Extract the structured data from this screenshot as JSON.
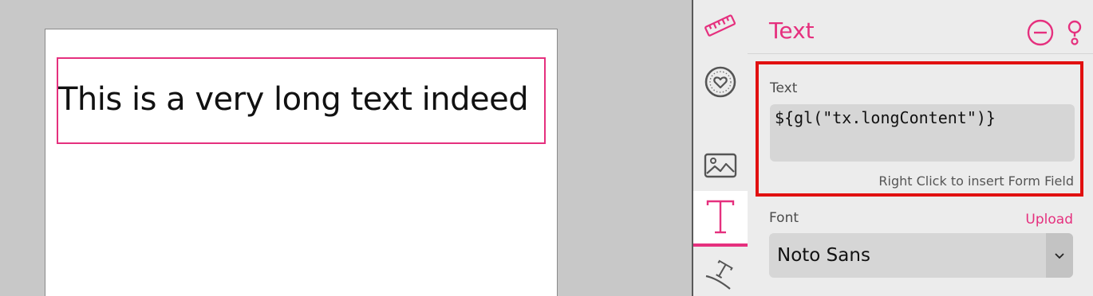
{
  "canvas": {
    "text_box_content": "This is a very long text indeed"
  },
  "toolbar": {
    "tools": [
      {
        "name": "ruler",
        "icon": "ruler-icon"
      },
      {
        "name": "heart",
        "icon": "heart-badge-icon"
      },
      {
        "name": "image",
        "icon": "image-icon"
      },
      {
        "name": "text",
        "icon": "text-cursor-icon",
        "active": true
      },
      {
        "name": "curve",
        "icon": "curved-text-icon"
      }
    ]
  },
  "panel": {
    "title": "Text",
    "text_section": {
      "label": "Text",
      "expression": "${gl(\"tx.longContent\")}",
      "hint": "Right Click to insert Form Field"
    },
    "font_label": "Font",
    "upload_label": "Upload",
    "font_value": "Noto Sans"
  },
  "colors": {
    "accent": "#e5307e",
    "highlight": "#e11010"
  }
}
